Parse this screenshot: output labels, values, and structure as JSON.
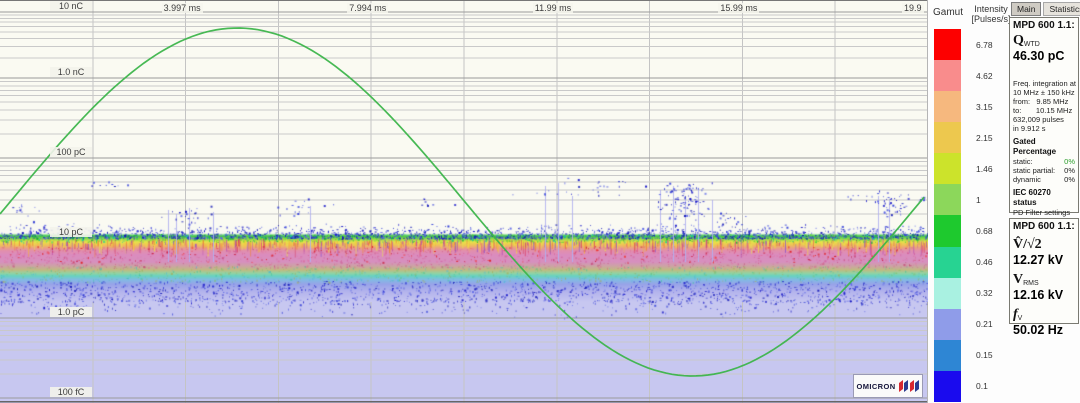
{
  "tabs": {
    "items": [
      {
        "label": "Main",
        "active": true
      },
      {
        "label": "Statistics",
        "active": false
      }
    ]
  },
  "chart": {
    "time_ticks": [
      "3.997 ms",
      "7.994 ms",
      "11.99 ms",
      "15.99 ms",
      "19.9"
    ],
    "charge_ticks": [
      "10 nC",
      "1.0 nC",
      "100 pC",
      "10 pC",
      "1.0 pC",
      "100 fC"
    ]
  },
  "chart_data": {
    "type": "heatmap",
    "description": "Time-resolved partial-discharge intensity map over one 50 Hz voltage cycle with superimposed test-voltage sine wave",
    "x_axis": {
      "unit": "ms",
      "range": [
        0,
        20
      ],
      "tick_labels": [
        "3.997 ms",
        "7.994 ms",
        "11.99 ms",
        "15.99 ms",
        "19.9"
      ]
    },
    "y_axis": {
      "scale": "log",
      "unit": "charge",
      "range_top": "10 nC",
      "range_bottom": "100 fC",
      "tick_labels": [
        "10 nC",
        "1.0 nC",
        "100 pC",
        "10 pC",
        "1.0 pC",
        "100 fC"
      ]
    },
    "legend": {
      "title": "Intensity [Pulses/s]",
      "position": "right",
      "levels": [
        "6.78",
        "4.62",
        "3.15",
        "2.15",
        "1.46",
        "1",
        "0.68",
        "0.46",
        "0.32",
        "0.21",
        "0.15",
        "0.1"
      ]
    },
    "voltage_wave": {
      "type": "line",
      "name": "test voltage",
      "color": "#3db54b",
      "frequency_hz": 50.02,
      "v_rms_kv": 12.16,
      "cycle_ms": 20,
      "positive_peak_ms": 5,
      "negative_peak_ms": 15
    },
    "noise_band": {
      "q_pC_range": [
        1.5,
        30
      ],
      "description": "continuous broadband noise floor centered near 5-10 pC with layered rainbow intensity colors; solid low-intensity (0.21 pulses/s) background below ~2 pC"
    },
    "clusters": [
      {
        "x_ms": [
          0.0,
          1.0
        ],
        "q_pC": [
          14,
          33
        ],
        "count": 16
      },
      {
        "x_ms": [
          1.6,
          2.9
        ],
        "q_pC": [
          38,
          58
        ],
        "count": 9
      },
      {
        "x_ms": [
          3.4,
          4.7
        ],
        "q_pC": [
          14,
          27
        ],
        "count": 24
      },
      {
        "x_ms": [
          5.6,
          7.4
        ],
        "q_pC": [
          17,
          35
        ],
        "count": 18
      },
      {
        "x_ms": [
          7.6,
          10.9
        ],
        "q_pC": [
          24,
          34
        ],
        "count": 8
      },
      {
        "x_ms": [
          11.0,
          14.1
        ],
        "q_pC": [
          33,
          58
        ],
        "count": 28
      },
      {
        "x_ms": [
          14.1,
          15.4
        ],
        "q_pC": [
          15,
          55
        ],
        "count": 95
      },
      {
        "x_ms": [
          15.4,
          16.1
        ],
        "q_pC": [
          13,
          22
        ],
        "count": 14
      },
      {
        "x_ms": [
          18.1,
          18.8
        ],
        "q_pC": [
          28,
          42
        ],
        "count": 7
      },
      {
        "x_ms": [
          18.7,
          19.6
        ],
        "q_pC": [
          16,
          44
        ],
        "count": 42
      },
      {
        "x_ms": [
          19.7,
          20.0
        ],
        "q_pC": [
          26,
          40
        ],
        "count": 5
      }
    ]
  },
  "gamut": {
    "title": "Gamut",
    "legend_line1": "Intensity",
    "legend_line2": "[Pulses/s]",
    "levels": [
      {
        "value": "6.78",
        "color": "#fd0000"
      },
      {
        "value": "4.62",
        "color": "#f98c8c"
      },
      {
        "value": "3.15",
        "color": "#f6b87e"
      },
      {
        "value": "2.15",
        "color": "#edc84e"
      },
      {
        "value": "1.46",
        "color": "#cce32b"
      },
      {
        "value": "1",
        "color": "#8cd75b"
      },
      {
        "value": "0.68",
        "color": "#1ec92e"
      },
      {
        "value": "0.46",
        "color": "#27d392"
      },
      {
        "value": "0.32",
        "color": "#a9f1e1"
      },
      {
        "value": "0.21",
        "color": "#8f9ce9"
      },
      {
        "value": "0.15",
        "color": "#2e86d4"
      },
      {
        "value": "0.1",
        "color": "#1a0bee"
      }
    ]
  },
  "panel1": {
    "title": "MPD 600 1.1:",
    "q_symbol": "Q",
    "q_subscript": "WTD",
    "q_value": "46.30 pC",
    "freq_lines": [
      "Freq. integration at",
      "10 MHz ± 150 kHz",
      "from:   9.85 MHz",
      "to:       10.15 MHz",
      "632,009 pulses",
      "in 9.912 s"
    ],
    "gated_title": "Gated Percentage",
    "gated_rows": [
      {
        "label": "static:",
        "value": "0%",
        "highlight": true
      },
      {
        "label": "static partial:",
        "value": "0%",
        "highlight": false
      },
      {
        "label": "dynamic",
        "value": "0%",
        "highlight": false
      }
    ],
    "iec_title": "IEC 60270 status",
    "iec_text": "PD Filter settings are outside of the recommended range."
  },
  "panel2": {
    "title": "MPD 600 1.1:",
    "rows": [
      {
        "symbol": "V̂/√2",
        "subscript": "",
        "italic": false,
        "value": "12.27 kV"
      },
      {
        "symbol": "V",
        "subscript": "RMS",
        "italic": false,
        "value": "12.16 kV"
      },
      {
        "symbol": "f",
        "subscript": "V",
        "italic": true,
        "value": "50.02 Hz"
      }
    ]
  },
  "logo": {
    "text": "OMICRON"
  },
  "colors": {
    "sine": "#3db54b",
    "background_low": "#c7c7f0",
    "grid_minor": "#c9c9c9",
    "grid_major": "#9b9b9b"
  }
}
